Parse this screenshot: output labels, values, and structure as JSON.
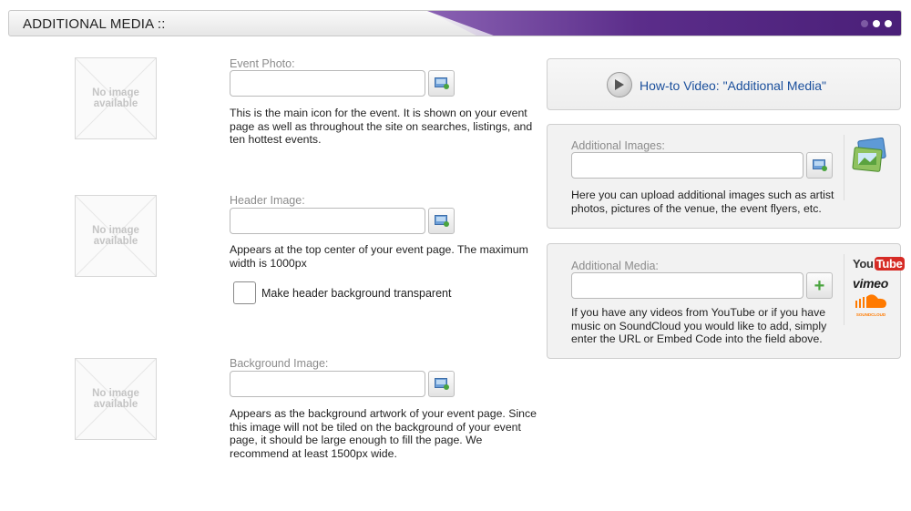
{
  "header": {
    "title": "ADDITIONAL MEDIA ::"
  },
  "placeholder": {
    "line1": "No image",
    "line2": "available"
  },
  "event_photo": {
    "label": "Event Photo:",
    "value": "",
    "description": "This is the main icon for the event. It is shown on your event page as well as throughout the site on searches, listings, and ten hottest events."
  },
  "header_image": {
    "label": "Header Image:",
    "value": "",
    "description": "Appears at the top center of your event page. The maximum width is 1000px",
    "checkbox_label": "Make header background transparent",
    "checkbox_checked": false
  },
  "background_image": {
    "label": "Background Image:",
    "value": "",
    "description": "Appears as the background artwork of your event page. Since this image will not be tiled on the background of your event page, it should be large enough to fill the page. We recommend at least 1500px wide."
  },
  "howto": {
    "link_text": "How-to Video: \"Additional Media\""
  },
  "additional_images": {
    "label": "Additional Images:",
    "value": "",
    "description": "Here you can upload additional images such as artist photos, pictures of the venue, the event flyers, etc."
  },
  "additional_media": {
    "label": "Additional Media:",
    "value": "",
    "description": "If you have any videos from YouTube or if you have music on SoundCloud you would like to add, simply enter the URL or Embed Code into the field above.",
    "logos": {
      "youtube_a": "You",
      "youtube_b": "Tube",
      "vimeo": "vimeo",
      "soundcloud": "SOUNDCLOUD"
    }
  },
  "colors": {
    "accent_purple": "#5b2d8a",
    "link_blue": "#1a4f9c",
    "add_green": "#4aa43f"
  }
}
